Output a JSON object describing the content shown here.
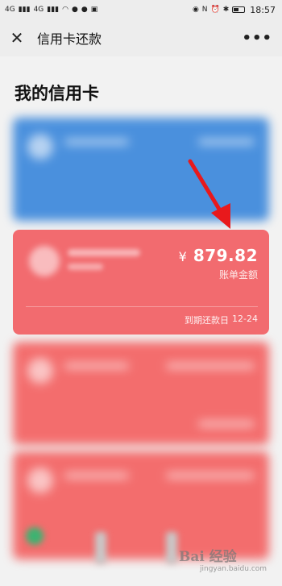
{
  "status_bar": {
    "network_1": "4G",
    "network_2": "4G",
    "battery": "",
    "time": "18:57"
  },
  "nav": {
    "title": "信用卡还款",
    "close_icon": "close-icon",
    "more_icon": "more-icon"
  },
  "page": {
    "heading": "我的信用卡"
  },
  "featured_card": {
    "currency": "¥",
    "amount": "879.82",
    "amount_label": "账单金额",
    "due_label": "到期还款日",
    "due_date": "12-24",
    "color": "#f26b6f"
  },
  "watermark": {
    "main": "Bai 经验",
    "sub": "jingyan.baidu.com"
  },
  "colors": {
    "blue_card": "#4a90dd",
    "red_card": "#f36d6d",
    "arrow": "#e8191c"
  }
}
